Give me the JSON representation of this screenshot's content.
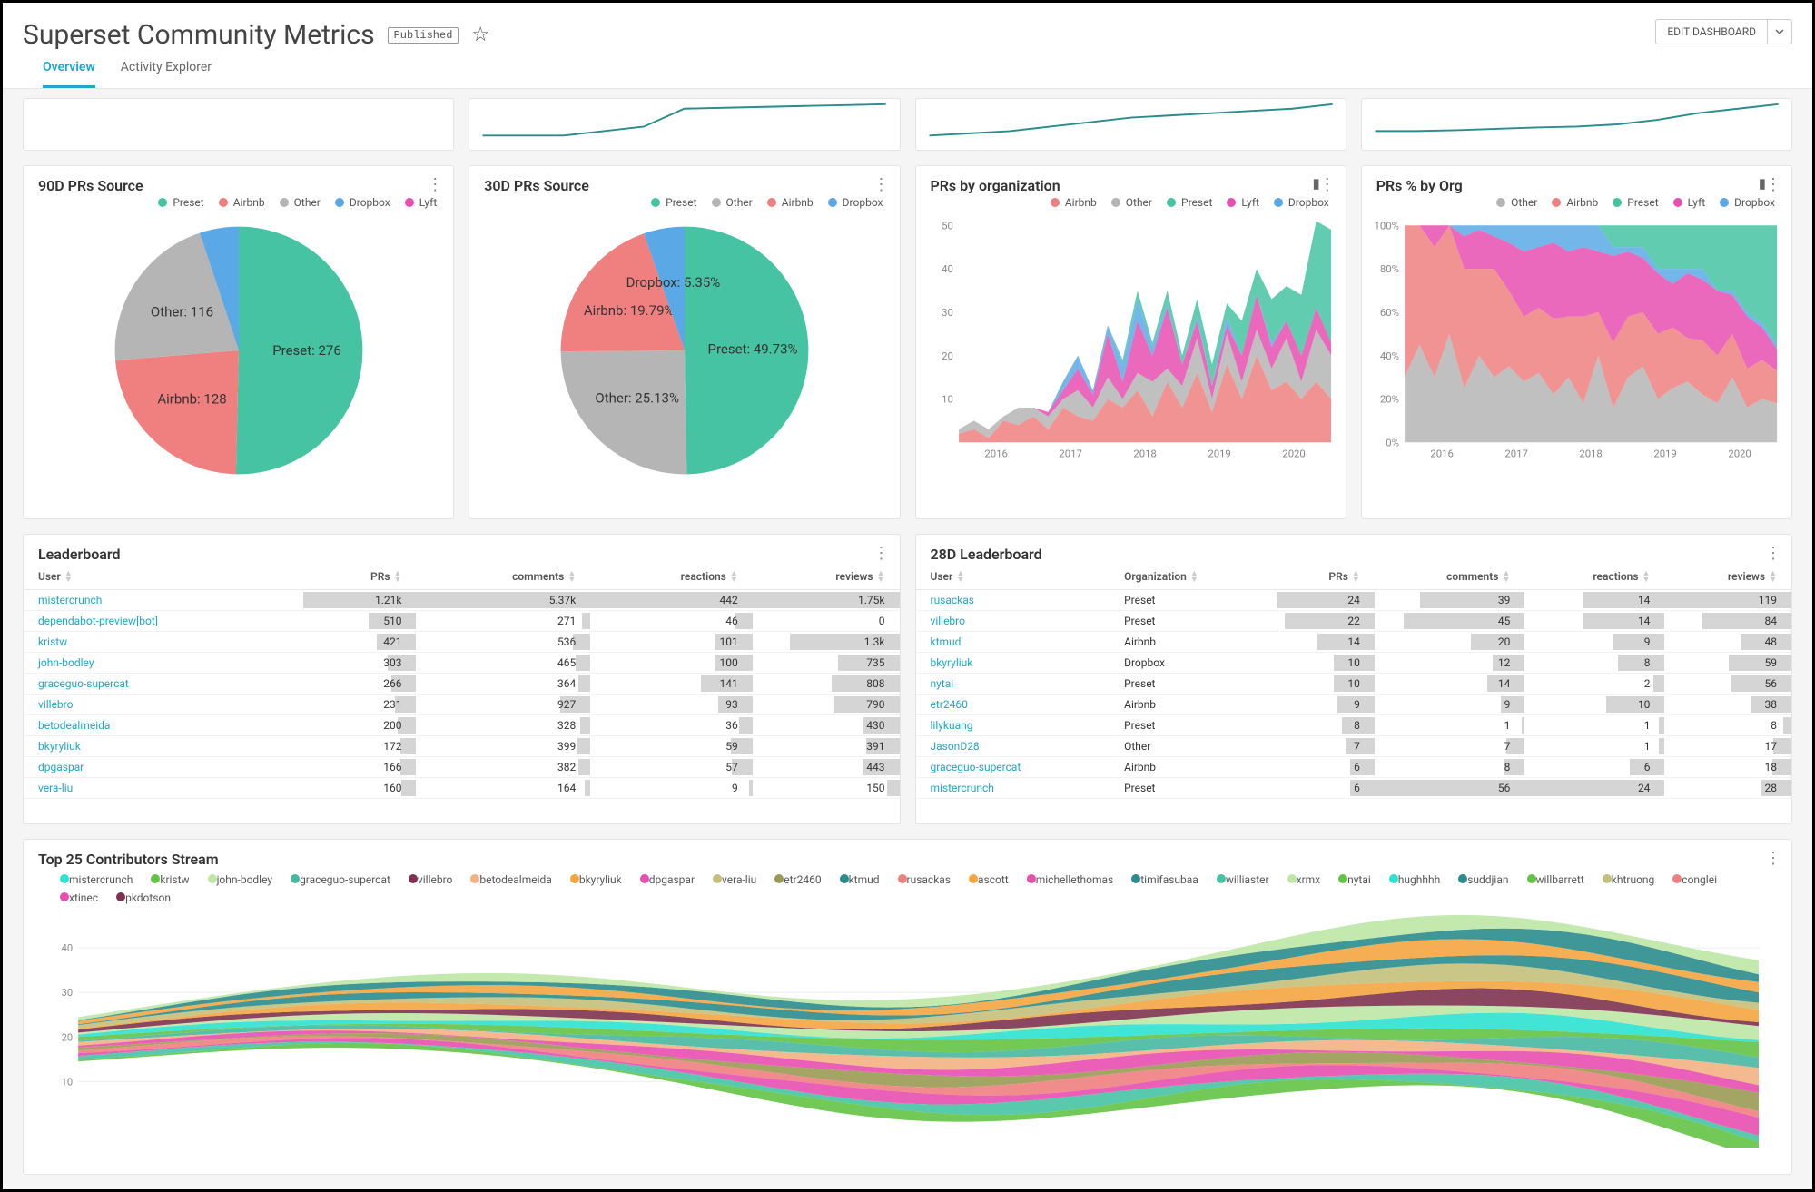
{
  "header": {
    "title": "Superset Community Metrics",
    "badge": "Published",
    "edit_button": "EDIT DASHBOARD"
  },
  "tabs": [
    "Overview",
    "Activity Explorer"
  ],
  "tabs_active": 0,
  "colors": {
    "preset": "#46c3a3",
    "airbnb": "#f08080",
    "other": "#b5b5b5",
    "dropbox": "#5aa9e6",
    "lyft": "#e84fb1",
    "stroke": "#2a8c8c"
  },
  "chart_data": [
    {
      "id": "spark1",
      "type": "line",
      "x": [
        0,
        1,
        2,
        3,
        4,
        5,
        6,
        7,
        8,
        9,
        10
      ],
      "values": [
        2,
        2,
        2,
        3,
        4,
        8,
        8.2,
        8.4,
        8.6,
        8.8,
        9
      ]
    },
    {
      "id": "spark2",
      "type": "line",
      "x": [
        0,
        1,
        2,
        3,
        4,
        5,
        6,
        7,
        8,
        9,
        10
      ],
      "values": [
        2,
        2.5,
        3,
        4,
        5,
        6,
        6.5,
        7,
        7.5,
        8,
        9
      ]
    },
    {
      "id": "spark3",
      "type": "line",
      "x": [
        0,
        1,
        2,
        3,
        4,
        5,
        6,
        7,
        8,
        9,
        10
      ],
      "values": [
        3,
        3,
        3.2,
        3.5,
        3.8,
        4,
        4.5,
        5.5,
        7,
        8,
        9
      ]
    },
    {
      "id": "pie90",
      "type": "pie",
      "title": "90D PRs Source",
      "legend": [
        {
          "name": "Preset",
          "color": "preset"
        },
        {
          "name": "Airbnb",
          "color": "airbnb"
        },
        {
          "name": "Other",
          "color": "other"
        },
        {
          "name": "Dropbox",
          "color": "dropbox"
        },
        {
          "name": "Lyft",
          "color": "lyft"
        }
      ],
      "slices": [
        {
          "name": "Preset",
          "value": 276,
          "label": "Preset: 276",
          "color": "preset"
        },
        {
          "name": "Airbnb",
          "value": 128,
          "label": "Airbnb: 128",
          "color": "airbnb"
        },
        {
          "name": "Other",
          "value": 116,
          "label": "Other: 116",
          "color": "other"
        },
        {
          "name": "Dropbox",
          "value": 28,
          "label": "",
          "color": "dropbox"
        }
      ]
    },
    {
      "id": "pie30",
      "type": "pie",
      "title": "30D PRs Source",
      "legend": [
        {
          "name": "Preset",
          "color": "preset"
        },
        {
          "name": "Other",
          "color": "other"
        },
        {
          "name": "Airbnb",
          "color": "airbnb"
        },
        {
          "name": "Dropbox",
          "color": "dropbox"
        }
      ],
      "slices": [
        {
          "name": "Preset",
          "value": 49.73,
          "label": "Preset: 49.73%",
          "color": "preset"
        },
        {
          "name": "Other",
          "value": 25.13,
          "label": "Other: 25.13%",
          "color": "other"
        },
        {
          "name": "Airbnb",
          "value": 19.79,
          "label": "Airbnb: 19.79%",
          "color": "airbnb"
        },
        {
          "name": "Dropbox",
          "value": 5.35,
          "label": "Dropbox: 5.35%",
          "color": "dropbox"
        }
      ]
    },
    {
      "id": "prs_org",
      "type": "area",
      "title": "PRs by organization",
      "stack": true,
      "legend": [
        {
          "name": "Airbnb",
          "color": "airbnb"
        },
        {
          "name": "Other",
          "color": "other"
        },
        {
          "name": "Preset",
          "color": "preset"
        },
        {
          "name": "Lyft",
          "color": "lyft"
        },
        {
          "name": "Dropbox",
          "color": "dropbox"
        }
      ],
      "x_labels": [
        "2016",
        "2017",
        "2018",
        "2019",
        "2020"
      ],
      "ylim": [
        0,
        50
      ],
      "yticks": [
        10,
        20,
        30,
        40,
        50
      ],
      "series": [
        {
          "name": "Airbnb",
          "color": "airbnb",
          "values": [
            2,
            3,
            1,
            5,
            4,
            6,
            3,
            8,
            6,
            5,
            10,
            8,
            12,
            6,
            14,
            8,
            16,
            7,
            18,
            10,
            20,
            12,
            14,
            10,
            14,
            10
          ]
        },
        {
          "name": "Other",
          "color": "other",
          "values": [
            1,
            2,
            2,
            1,
            4,
            2,
            3,
            2,
            6,
            3,
            5,
            2,
            4,
            8,
            3,
            5,
            8,
            3,
            7,
            4,
            6,
            5,
            10,
            4,
            12,
            10
          ]
        },
        {
          "name": "Lyft",
          "color": "lyft",
          "values": [
            0,
            0,
            0,
            0,
            0,
            0,
            1,
            2,
            5,
            3,
            10,
            4,
            12,
            6,
            14,
            5,
            4,
            3,
            2,
            6,
            8,
            5,
            4,
            6,
            5,
            3
          ]
        },
        {
          "name": "Dropbox",
          "color": "dropbox",
          "values": [
            0,
            0,
            0,
            0,
            0,
            0,
            0,
            2,
            3,
            1,
            2,
            4,
            5,
            2,
            1,
            0,
            1,
            0,
            2,
            0,
            0,
            1,
            0,
            0,
            0,
            0
          ]
        },
        {
          "name": "Preset",
          "color": "preset",
          "values": [
            0,
            0,
            0,
            0,
            0,
            0,
            0,
            0,
            0,
            0,
            0,
            1,
            2,
            1,
            3,
            2,
            4,
            5,
            3,
            8,
            6,
            10,
            8,
            14,
            20,
            26
          ]
        }
      ]
    },
    {
      "id": "prs_pct_org",
      "type": "area",
      "title": "PRs % by Org",
      "stack": true,
      "percent": true,
      "legend": [
        {
          "name": "Other",
          "color": "other"
        },
        {
          "name": "Airbnb",
          "color": "airbnb"
        },
        {
          "name": "Preset",
          "color": "preset"
        },
        {
          "name": "Lyft",
          "color": "lyft"
        },
        {
          "name": "Dropbox",
          "color": "dropbox"
        }
      ],
      "x_labels": [
        "2016",
        "2017",
        "2018",
        "2019",
        "2020"
      ],
      "ylim": [
        0,
        100
      ],
      "yticks": [
        0,
        20,
        40,
        60,
        80,
        100
      ],
      "ysuffix": "%",
      "series": [
        {
          "name": "Other",
          "color": "other",
          "values": [
            30,
            45,
            30,
            50,
            25,
            40,
            30,
            35,
            28,
            32,
            22,
            30,
            18,
            40,
            16,
            30,
            35,
            20,
            25,
            28,
            22,
            18,
            30,
            16,
            20,
            18
          ]
        },
        {
          "name": "Airbnb",
          "color": "airbnb",
          "values": [
            70,
            55,
            60,
            50,
            55,
            40,
            50,
            35,
            30,
            30,
            35,
            28,
            40,
            20,
            30,
            28,
            25,
            30,
            28,
            20,
            25,
            22,
            20,
            18,
            18,
            15
          ]
        },
        {
          "name": "Lyft",
          "color": "lyft",
          "values": [
            0,
            0,
            10,
            0,
            15,
            18,
            15,
            22,
            30,
            28,
            35,
            30,
            32,
            28,
            40,
            30,
            25,
            28,
            20,
            30,
            28,
            30,
            18,
            24,
            15,
            10
          ]
        },
        {
          "name": "Dropbox",
          "color": "dropbox",
          "values": [
            0,
            0,
            0,
            0,
            5,
            2,
            5,
            8,
            12,
            10,
            8,
            12,
            10,
            12,
            4,
            2,
            5,
            2,
            7,
            2,
            5,
            0,
            2,
            2,
            2,
            2
          ]
        },
        {
          "name": "Preset",
          "color": "preset",
          "values": [
            0,
            0,
            0,
            0,
            0,
            0,
            0,
            0,
            0,
            0,
            0,
            0,
            0,
            0,
            10,
            10,
            10,
            20,
            20,
            20,
            20,
            30,
            30,
            40,
            45,
            55
          ]
        }
      ]
    },
    {
      "id": "stream",
      "type": "stream",
      "title": "Top 25 Contributors Stream",
      "ylim": [
        0,
        45
      ],
      "yticks": [
        10,
        20,
        30,
        40
      ],
      "legend": [
        {
          "name": "mistercrunch",
          "color": "#2de2d0"
        },
        {
          "name": "kristw",
          "color": "#63c346"
        },
        {
          "name": "john-bodley",
          "color": "#bde7a5"
        },
        {
          "name": "graceguo-supercat",
          "color": "#48b8a1"
        },
        {
          "name": "villebro",
          "color": "#7e324f"
        },
        {
          "name": "betodealmeida",
          "color": "#f4b183"
        },
        {
          "name": "bkyryliuk",
          "color": "#f4a540"
        },
        {
          "name": "dpgaspar",
          "color": "#e84fb1"
        },
        {
          "name": "vera-liu",
          "color": "#c3c07b"
        },
        {
          "name": "etr2460",
          "color": "#9a9a54"
        },
        {
          "name": "ktmud",
          "color": "#2a8c8c"
        },
        {
          "name": "rusackas",
          "color": "#f08080"
        },
        {
          "name": "ascott",
          "color": "#f4a540"
        },
        {
          "name": "michellethomas",
          "color": "#e84fb1"
        },
        {
          "name": "timifasubaa",
          "color": "#2a8c8c"
        },
        {
          "name": "williaster",
          "color": "#46c3a3"
        },
        {
          "name": "xrmx",
          "color": "#bde7a5"
        },
        {
          "name": "nytai",
          "color": "#63c346"
        },
        {
          "name": "hughhhh",
          "color": "#2de2d0"
        },
        {
          "name": "suddjian",
          "color": "#2a8c8c"
        },
        {
          "name": "willbarrett",
          "color": "#63c346"
        },
        {
          "name": "khtruong",
          "color": "#c3c07b"
        },
        {
          "name": "conglei",
          "color": "#f08080"
        },
        {
          "name": "xtinec",
          "color": "#e84fb1"
        },
        {
          "name": "pkdotson",
          "color": "#7e324f"
        }
      ]
    }
  ],
  "leaderboard": {
    "title": "Leaderboard",
    "columns": [
      "User",
      "PRs",
      "comments",
      "reactions",
      "reviews"
    ],
    "max": {
      "PRs": 1210,
      "comments": 5370,
      "reactions": 442,
      "reviews": 1750
    },
    "rows": [
      {
        "user": "mistercrunch",
        "PRs": "1.21k",
        "PRs_n": 1210,
        "comments": "5.37k",
        "comments_n": 5370,
        "reactions": 442,
        "reviews": "1.75k",
        "reviews_n": 1750
      },
      {
        "user": "dependabot-preview[bot]",
        "PRs": 510,
        "PRs_n": 510,
        "comments": 271,
        "comments_n": 271,
        "reactions": 46,
        "reviews": 0,
        "reviews_n": 0
      },
      {
        "user": "kristw",
        "PRs": 421,
        "PRs_n": 421,
        "comments": 536,
        "comments_n": 536,
        "reactions": 101,
        "reviews": "1.3k",
        "reviews_n": 1300
      },
      {
        "user": "john-bodley",
        "PRs": 303,
        "PRs_n": 303,
        "comments": 465,
        "comments_n": 465,
        "reactions": 100,
        "reviews": 735,
        "reviews_n": 735
      },
      {
        "user": "graceguo-supercat",
        "PRs": 266,
        "PRs_n": 266,
        "comments": 364,
        "comments_n": 364,
        "reactions": 141,
        "reviews": 808,
        "reviews_n": 808
      },
      {
        "user": "villebro",
        "PRs": 231,
        "PRs_n": 231,
        "comments": 927,
        "comments_n": 927,
        "reactions": 93,
        "reviews": 790,
        "reviews_n": 790
      },
      {
        "user": "betodealmeida",
        "PRs": 200,
        "PRs_n": 200,
        "comments": 328,
        "comments_n": 328,
        "reactions": 36,
        "reviews": 430,
        "reviews_n": 430
      },
      {
        "user": "bkyryliuk",
        "PRs": 172,
        "PRs_n": 172,
        "comments": 399,
        "comments_n": 399,
        "reactions": 59,
        "reviews": 391,
        "reviews_n": 391
      },
      {
        "user": "dpgaspar",
        "PRs": 166,
        "PRs_n": 166,
        "comments": 382,
        "comments_n": 382,
        "reactions": 57,
        "reviews": 443,
        "reviews_n": 443
      },
      {
        "user": "vera-liu",
        "PRs": 160,
        "PRs_n": 160,
        "comments": 164,
        "comments_n": 164,
        "reactions": 9,
        "reviews": 150,
        "reviews_n": 150
      }
    ]
  },
  "leaderboard28": {
    "title": "28D Leaderboard",
    "columns": [
      "User",
      "Organization",
      "PRs",
      "comments",
      "reactions",
      "reviews"
    ],
    "max": {
      "PRs": 24,
      "comments": 56,
      "reactions": 24,
      "reviews": 119
    },
    "rows": [
      {
        "user": "rusackas",
        "org": "Preset",
        "PRs": 24,
        "comments": 39,
        "reactions": 14,
        "reviews": 119
      },
      {
        "user": "villebro",
        "org": "Preset",
        "PRs": 22,
        "comments": 45,
        "reactions": 14,
        "reviews": 84
      },
      {
        "user": "ktmud",
        "org": "Airbnb",
        "PRs": 14,
        "comments": 20,
        "reactions": 9,
        "reviews": 48
      },
      {
        "user": "bkyryliuk",
        "org": "Dropbox",
        "PRs": 10,
        "comments": 12,
        "reactions": 8,
        "reviews": 59
      },
      {
        "user": "nytai",
        "org": "Preset",
        "PRs": 10,
        "comments": 14,
        "reactions": 2,
        "reviews": 56
      },
      {
        "user": "etr2460",
        "org": "Airbnb",
        "PRs": 9,
        "comments": 9,
        "reactions": 10,
        "reviews": 38
      },
      {
        "user": "lilykuang",
        "org": "Preset",
        "PRs": 8,
        "comments": 1,
        "reactions": 1,
        "reviews": 8
      },
      {
        "user": "JasonD28",
        "org": "Other",
        "PRs": 7,
        "comments": 7,
        "reactions": 1,
        "reviews": 17
      },
      {
        "user": "graceguo-supercat",
        "org": "Airbnb",
        "PRs": 6,
        "comments": 8,
        "reactions": 6,
        "reviews": 18
      },
      {
        "user": "mistercrunch",
        "org": "Preset",
        "PRs": 6,
        "comments": 56,
        "reactions": 24,
        "reviews": 28
      }
    ]
  }
}
